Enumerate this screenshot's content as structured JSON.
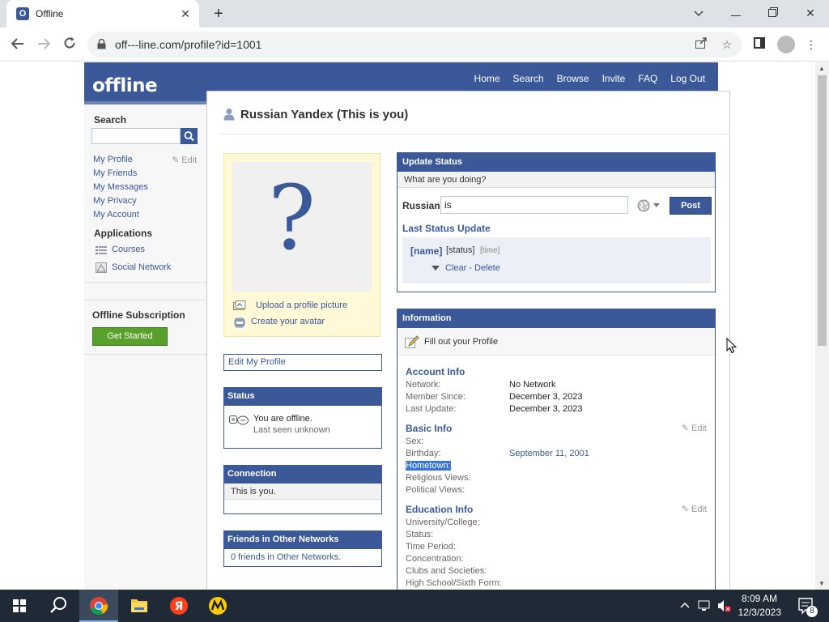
{
  "browser": {
    "tab_title": "Offline",
    "tab_favicon_letter": "O",
    "url": "off---line.com/profile?id=1001"
  },
  "site": {
    "logo": "offline",
    "nav": [
      "Home",
      "Search",
      "Browse",
      "Invite",
      "FAQ",
      "Log Out"
    ]
  },
  "sidebar": {
    "search_label": "Search",
    "links": [
      "My Profile",
      "My Friends",
      "My Messages",
      "My Privacy",
      "My Account"
    ],
    "edit_label": "Edit",
    "applications_label": "Applications",
    "apps": [
      {
        "label": "Courses",
        "icon": "list-icon"
      },
      {
        "label": "Social Network",
        "icon": "network-icon"
      }
    ],
    "subscription_label": "Offline Subscription",
    "get_started": "Get Started"
  },
  "profile": {
    "title": "Russian Yandex (This is you)",
    "upload_picture": "Upload a profile picture",
    "create_avatar": "Create your avatar",
    "edit_profile": "Edit My Profile",
    "status_panel": {
      "title": "Status",
      "line1": "You are offline.",
      "line2": "Last seen unknown"
    },
    "connection_panel": {
      "title": "Connection",
      "text": "This is you."
    },
    "friends_panel": {
      "title": "Friends in Other Networks",
      "text": "0 friends in Other Networks."
    }
  },
  "update_status": {
    "title": "Update Status",
    "prompt": "What are you doing?",
    "name": "Russian",
    "input_value": "is",
    "post": "Post",
    "last_label": "Last Status Update",
    "last_name": "[name]",
    "last_status": "[status]",
    "last_time": "[time]",
    "actions": "Clear - Delete"
  },
  "information": {
    "title": "Information",
    "fill_out": "Fill out your Profile",
    "edit_label": "Edit",
    "account_info": {
      "title": "Account Info",
      "rows": [
        {
          "label": "Network:",
          "value": "No Network"
        },
        {
          "label": "Member Since:",
          "value": "December 3, 2023"
        },
        {
          "label": "Last Update:",
          "value": "December 3, 2023"
        }
      ]
    },
    "basic_info": {
      "title": "Basic Info",
      "rows": [
        {
          "label": "Sex:",
          "value": ""
        },
        {
          "label": "Birthday:",
          "value": "September 11, 2001"
        },
        {
          "label": "Hometown:",
          "value": ""
        },
        {
          "label": "Religious Views:",
          "value": ""
        },
        {
          "label": "Political Views:",
          "value": ""
        }
      ]
    },
    "education_info": {
      "title": "Education Info",
      "rows": [
        {
          "label": "University/College:",
          "value": ""
        },
        {
          "label": "Status:",
          "value": ""
        },
        {
          "label": "Time Period:",
          "value": ""
        },
        {
          "label": "Concentration:",
          "value": ""
        },
        {
          "label": "Clubs and Societies:",
          "value": ""
        },
        {
          "label": "High School/Sixth Form:",
          "value": ""
        }
      ]
    }
  },
  "taskbar": {
    "time": "8:09 AM",
    "date": "12/3/2023",
    "notification_count": "8"
  },
  "colors": {
    "brand": "#3b5998",
    "brand_light": "#6d84b4",
    "green": "#5aa02c",
    "photo_bg": "#fff9d7",
    "selection": "#3875d7"
  }
}
